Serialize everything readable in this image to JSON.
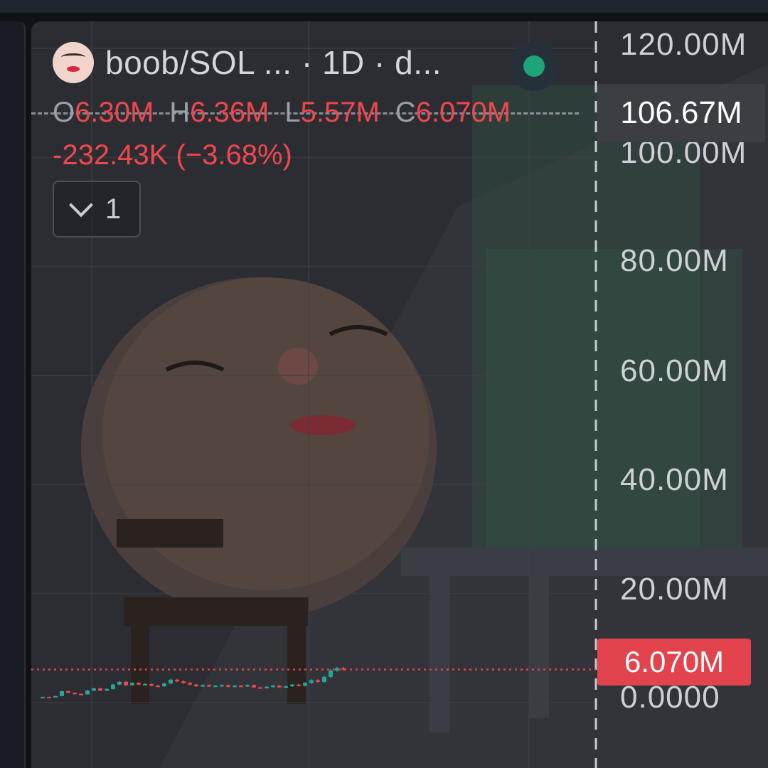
{
  "header": {
    "title": "boob/SOL ... · 1D · d...",
    "ohlc": {
      "open_label": "O",
      "open": "6.30M",
      "high_label": "H",
      "high": "6.36M",
      "low_label": "L",
      "low": "5.57M",
      "close_label": "C",
      "close": "6.070M"
    },
    "change": "-232.43K (−3.68%)",
    "indicator_toggle_count": "1"
  },
  "axis": {
    "crosshair_label": "106.67M",
    "price_label": "6.070M"
  },
  "colors": {
    "up": "#26a69a",
    "down": "#f0474d",
    "live": "#1fa37a"
  },
  "chart_data": {
    "type": "candlestick",
    "y_ticks": [
      "120.00M",
      "100.00M",
      "80.00M",
      "60.00M",
      "40.00M",
      "20.00M",
      "0.0000"
    ],
    "ylim": [
      0,
      120000000
    ],
    "last_price": 6070000,
    "series": [
      {
        "values": [
          1.0,
          1.05,
          1.0,
          1.2,
          2.1,
          1.8,
          1.6,
          1.5,
          2.2,
          2.6,
          2.2,
          2.5,
          3.3,
          3.8,
          3.2,
          3.6,
          3.3,
          3.4,
          3.1,
          3.0,
          3.5,
          4.2,
          3.9,
          3.6,
          3.3,
          3.0,
          3.2,
          3.0,
          3.1,
          3.2,
          2.9,
          3.1,
          3.0,
          3.2,
          2.8,
          2.7,
          2.9,
          3.1,
          2.8,
          3.0,
          3.3,
          3.1,
          3.6,
          4.1,
          3.8,
          4.7,
          5.9,
          6.3,
          6.07
        ]
      }
    ],
    "value_unit": "M"
  }
}
